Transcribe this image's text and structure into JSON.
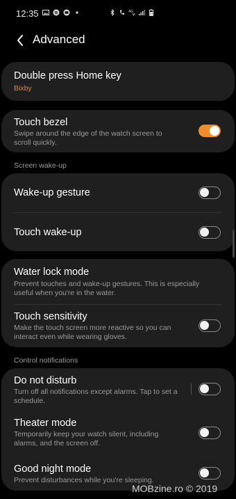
{
  "status": {
    "time": "12:35",
    "icons_left": [
      "image-icon",
      "spotify-icon",
      "mail-icon",
      "dot-icon"
    ],
    "icons_right": [
      "bluetooth-icon",
      "wifi-call-icon",
      "lte-icon",
      "signal-icon",
      "battery-icon"
    ]
  },
  "header": {
    "title": "Advanced"
  },
  "items": {
    "double_press": {
      "title": "Double press Home key",
      "sub": "Bixby"
    },
    "touch_bezel": {
      "title": "Touch bezel",
      "sub": "Swipe around the edge of the watch screen to scroll quickly.",
      "on": true
    },
    "wake_section": "Screen wake-up",
    "wake_gesture": {
      "title": "Wake-up gesture",
      "on": false
    },
    "touch_wake": {
      "title": "Touch wake-up",
      "on": false
    },
    "water_lock": {
      "title": "Water lock mode",
      "sub": "Prevent touches and wake-up gestures. This is especially useful when you're in the water."
    },
    "touch_sensitivity": {
      "title": "Touch sensitivity",
      "sub": "Make the touch screen more reactive so you can interact even while wearing gloves.",
      "on": false
    },
    "notif_section": "Control notifications",
    "dnd": {
      "title": "Do not disturb",
      "sub": "Turn off all notifications except alarms. Tap to set a schedule.",
      "on": false
    },
    "theater": {
      "title": "Theater mode",
      "sub": "Temporarily keep your watch silent, including alarms, and the screen off.",
      "on": false
    },
    "good_night": {
      "title": "Good night mode",
      "sub": "Prevent disturbances while you're sleeping.",
      "on": false
    }
  },
  "colors": {
    "accent": "#ef8c2c",
    "card": "#1f1f1f",
    "background": "#000000"
  },
  "watermark": "MOBzine.ro © 2019"
}
